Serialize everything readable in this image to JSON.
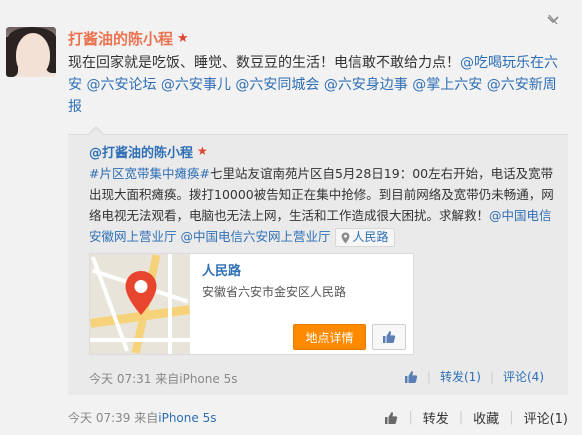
{
  "post": {
    "username": "打酱油的陈小程",
    "text_before": "现在回家就是吃饭、睡觉、数豆豆的生活！电信敢不敢给力点！",
    "mentions": [
      "@吃喝玩乐在六安",
      "@六安论坛",
      "@六安事儿",
      "@六安同城会",
      "@六安身边事",
      "@掌上六安",
      "@六安新周报"
    ],
    "time": "今天 07:39",
    "source_prefix": "来自",
    "source": "iPhone 5s",
    "actions": {
      "repost": "转发",
      "favorite": "收藏",
      "comment": "评论(1)"
    }
  },
  "repost": {
    "username": "@打酱油的陈小程",
    "hashtag": "#片区宽带集中瘫痪#",
    "text": "七里站友谊南苑片区自5月28日19：00左右开始，电话及宽带出现大面积瘫痪。拨打10000被告知正在集中抢修。到目前网络及宽带仍未畅通，网络电视无法观看，电脑也无法上网，生活和工作造成很大困扰。求解救！",
    "mentions": [
      "@中国电信安徽网上营业厅",
      "@中国电信六安网上营业厅"
    ],
    "location_chip": "人民路",
    "map": {
      "title": "人民路",
      "address": "安徽省六安市金安区人民路",
      "detail_button": "地点详情"
    },
    "time": "今天 07:31",
    "source_prefix": "来自",
    "source": "iPhone 5s",
    "actions": {
      "repost": "转发(1)",
      "comment": "评论(4)"
    }
  },
  "colors": {
    "name": "#eb7350",
    "link": "#2f6fb5",
    "button": "#ff8a00"
  },
  "icons": [
    "vip-badge-icon",
    "dismiss-chevron-icon",
    "location-pin-icon",
    "map-marker-icon",
    "thumbs-up-icon"
  ]
}
